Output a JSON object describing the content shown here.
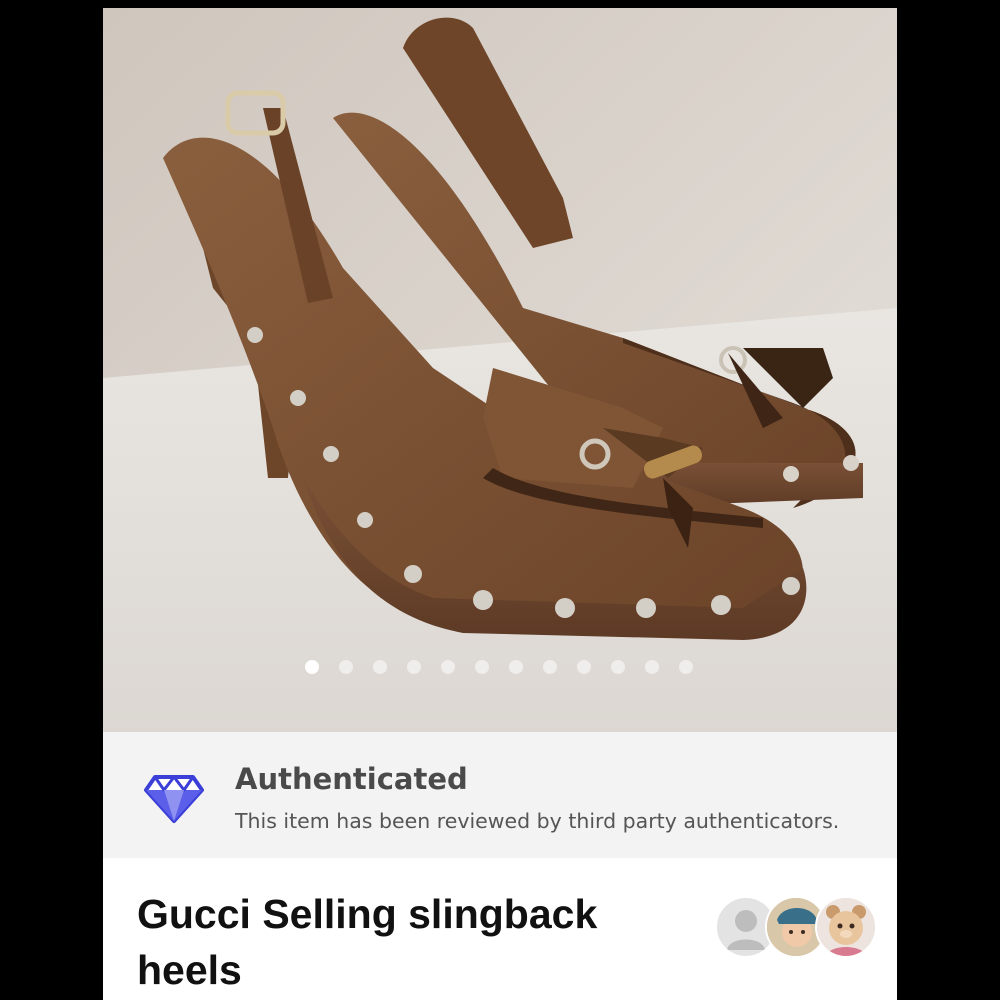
{
  "gallery": {
    "image_alt": "Brown leather slingback heels with studded platform and bamboo tassels",
    "dot_count": 12,
    "active_index": 0
  },
  "auth": {
    "title": "Authenticated",
    "subtitle": "This item has been reviewed by third party authenticators.",
    "icon": "diamond-icon",
    "accent_color": "#3b3fd8"
  },
  "listing": {
    "title": "Gucci Selling slingback heels"
  },
  "likers": {
    "avatars": [
      "default-user-avatar",
      "child-photo-avatar",
      "bear-photo-avatar"
    ]
  }
}
